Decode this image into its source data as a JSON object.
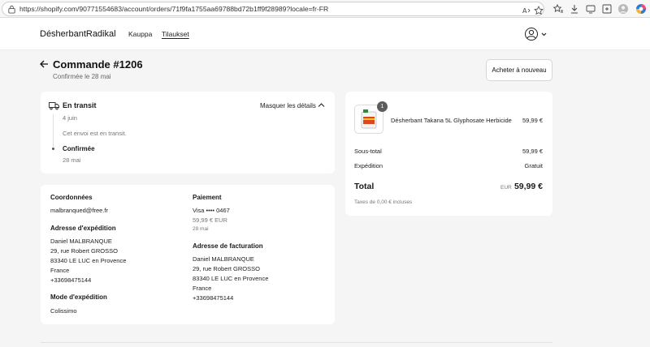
{
  "browser": {
    "url": "https://shopify.com/90771554683/account/orders/71f9fa1755aa69788bd72b1ff9f28989?locale=fr-FR"
  },
  "store": {
    "brand": "DésherbantRadikal",
    "nav": [
      {
        "label": "Kauppa"
      },
      {
        "label": "Tilaukset"
      }
    ]
  },
  "order": {
    "title": "Commande #1206",
    "subtitle": "Confirmée le 28 mai",
    "buy_again_label": "Acheter à nouveau"
  },
  "status": {
    "transit_label": "En transit",
    "transit_date": "4 juin",
    "transit_message": "Cet envoi est en transit.",
    "hide_details_label": "Masquer les détails",
    "confirmed_label": "Confirmée",
    "confirmed_date": "28 mai"
  },
  "details": {
    "contact_heading": "Coordonnées",
    "email": "malbranqued@free.fr",
    "shipping_address_heading": "Adresse d'expédition",
    "shipping_address": [
      "Daniel MALBRANQUE",
      "29, rue Robert GROSSO",
      "83340 LE LUC en Provence",
      "France",
      "+33698475144"
    ],
    "shipping_method_heading": "Mode d'expédition",
    "shipping_method": "Colissimo",
    "payment_heading": "Paiement",
    "payment_card": "Visa •••• 0467",
    "payment_amount": "59,99 € EUR",
    "payment_date": "28 mai",
    "billing_address_heading": "Adresse de facturation",
    "billing_address": [
      "Daniel MALBRANQUE",
      "29, rue Robert GROSSO",
      "83340 LE LUC en Provence",
      "France",
      "+33698475144"
    ]
  },
  "summary": {
    "product_name": "Désherbant Takana 5L Glyphosate Herbicide",
    "product_price": "59,99 €",
    "quantity": "1",
    "subtotal_label": "Sous-total",
    "subtotal_value": "59,99 €",
    "shipping_label": "Expédition",
    "shipping_value": "Gratuit",
    "total_label": "Total",
    "currency": "EUR",
    "total_value": "59,99 €",
    "taxes_note": "Taxes de 0,00 € incluses"
  },
  "colors": {
    "background": "#f5f5f5",
    "card": "#ffffff",
    "text": "#1a1a1a",
    "muted": "#777777",
    "badge": "#5c5c5c"
  }
}
